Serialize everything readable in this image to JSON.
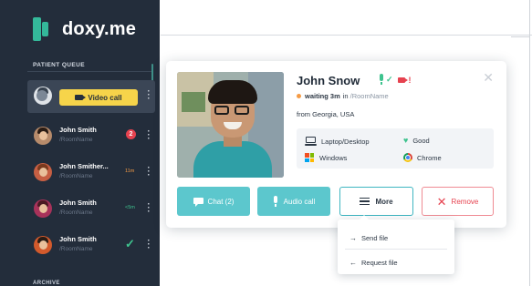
{
  "app": {
    "logo_text": "doxy.me",
    "brand_color": "#34b99a",
    "sidebar_color": "#232d3b"
  },
  "sidebar": {
    "section_title": "PATIENT QUEUE",
    "active_row": {
      "button_label": "Video call",
      "button_color": "#f6d44a",
      "icon": "video-camera-icon"
    },
    "patients": [
      {
        "name": "John Smith",
        "room": "/RoomName",
        "indicator": "badge",
        "badge_count": "2",
        "badge_color": "#e6424f"
      },
      {
        "name": "John Smither...",
        "room": "/RoomName",
        "indicator": "time",
        "time": "11m",
        "time_color": "#f59b45"
      },
      {
        "name": "John Smith",
        "room": "/RoomName",
        "indicator": "time",
        "time": "<5m",
        "time_color": "#3ec38e"
      },
      {
        "name": "John Smith",
        "room": "/RoomName",
        "indicator": "check",
        "check_glyph": "✓",
        "check_color": "#3ec38e"
      }
    ],
    "bottom_section_peek": "ARCHIVE"
  },
  "card": {
    "patient_name": "John Snow",
    "mic_icon": "microphone-icon",
    "camera_icon": "video-camera-icon",
    "mic_ok_glyph": "✓",
    "camera_warning_glyph": "!",
    "close_glyph": "✕",
    "status": {
      "waiting": "waiting 3m",
      "in_text": "in",
      "room": "/RoomName",
      "dot_color": "#f59b45"
    },
    "location": "from Georgia, USA",
    "tech": {
      "device": "Laptop/Desktop",
      "connection": "Good",
      "os": "Windows",
      "browser": "Chrome",
      "signal_glyph": "♥"
    },
    "actions": {
      "chat": "Chat (2)",
      "audio": "Audio call",
      "more": "More",
      "remove": "Remove",
      "remove_glyph": "✕",
      "accent_color": "#5cc7cd",
      "danger_color": "#e6424f"
    }
  },
  "dropdown": {
    "items": [
      {
        "label": "Send file",
        "arrow": "→"
      },
      {
        "label": "Request file",
        "arrow": "←"
      }
    ]
  }
}
